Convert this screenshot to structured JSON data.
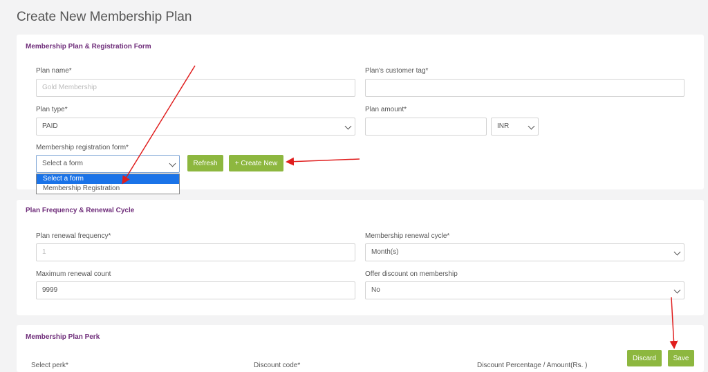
{
  "page": {
    "title": "Create New Membership Plan"
  },
  "section1": {
    "title": "Membership Plan & Registration Form",
    "plan_name_label": "Plan name*",
    "plan_name_placeholder": "Gold Membership",
    "customer_tag_label": "Plan's customer tag*",
    "customer_tag_value": "",
    "plan_type_label": "Plan type*",
    "plan_type_value": "PAID",
    "plan_amount_label": "Plan amount*",
    "plan_amount_value": "",
    "currency_value": "INR",
    "reg_form_label": "Membership registration form*",
    "reg_form_value": "Select a form",
    "refresh_label": "Refresh",
    "create_new_label": "+ Create New",
    "dropdown_options": [
      "Select a form",
      "Membership Registration"
    ]
  },
  "section2": {
    "title": "Plan Frequency & Renewal Cycle",
    "renewal_frequency_label": "Plan renewal frequency*",
    "renewal_frequency_placeholder": "1",
    "renewal_cycle_label": "Membership renewal cycle*",
    "renewal_cycle_value": "Month(s)",
    "max_renewal_label": "Maximum renewal count",
    "max_renewal_value": "9999",
    "offer_discount_label": "Offer discount on membership",
    "offer_discount_value": "No"
  },
  "section3": {
    "title": "Membership Plan Perk",
    "select_perk_label": "Select perk*",
    "discount_code_label": "Discount code*",
    "discount_amount_label": "Discount Percentage / Amount(Rs. )",
    "discard_label": "Discard",
    "save_label": "Save"
  },
  "colors": {
    "accent_green": "#8db73f",
    "section_title": "#6f2d7a",
    "annotation_red": "#e01e1e",
    "selected_option": "#1a73e8"
  }
}
